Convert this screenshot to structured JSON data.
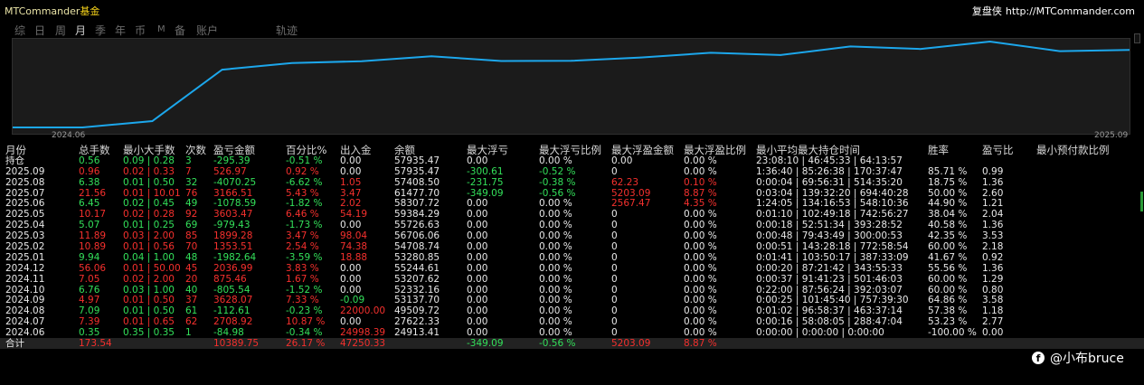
{
  "app": {
    "title_en": "MTCommander",
    "title_cn": "基金",
    "brand_cn": "复盘侠",
    "brand_url": "http://MTCommander.com"
  },
  "tabs": [
    {
      "label": "综",
      "active": false
    },
    {
      "label": "日",
      "active": false
    },
    {
      "label": "周",
      "active": false
    },
    {
      "label": "月",
      "active": true
    },
    {
      "label": "季",
      "active": false
    },
    {
      "label": "年",
      "active": false
    },
    {
      "label": "币",
      "active": false
    },
    {
      "label": "M",
      "active": false
    },
    {
      "label": "备",
      "active": false
    },
    {
      "label": "账户",
      "active": false
    },
    {
      "label": "轨迹",
      "active": false
    }
  ],
  "chart_data": {
    "type": "line",
    "x_tick_labels": [
      "2024.06",
      "2025.09"
    ],
    "series": [
      {
        "color": "#1ca7ec",
        "values": [
          24913.41,
          24913.41,
          27622.33,
          49509.72,
          52332.16,
          53137.7,
          55244.61,
          53207.62,
          53280.85,
          54708.74,
          56706.06,
          55726.63,
          59384.29,
          58307.72,
          61477.7,
          57408.5,
          57935.47
        ]
      }
    ]
  },
  "table": {
    "headers": [
      "月份",
      "总手数",
      "最小大手数",
      "次数",
      "盈亏金额",
      "百分比%",
      "出入金",
      "余额",
      "最大浮亏",
      "最大浮亏比例",
      "最大浮盈金额",
      "最大浮盈比例",
      "最小平均最大持仓时间",
      "胜率",
      "盈亏比",
      "最小预付款比例"
    ],
    "rows": [
      {
        "c": [
          "持仓",
          "0.56",
          "0.09 | 0.28",
          "3",
          "-295.39",
          "-0.51 %",
          "0.00",
          "57935.47",
          "0.00",
          "0.00 %",
          "0.00",
          "0.00 %",
          "23:08:10 | 46:45:33 | 64:13:57",
          "",
          "",
          ""
        ],
        "k": [
          "w",
          "g",
          "g",
          "g",
          "g",
          "g",
          "w",
          "w",
          "w",
          "w",
          "w",
          "w",
          "w",
          "w",
          "w",
          "w"
        ]
      },
      {
        "c": [
          "2025.09",
          "0.96",
          "0.02 | 0.33",
          "7",
          "526.97",
          "0.92 %",
          "0.00",
          "57935.47",
          "-300.61",
          "-0.52 %",
          "0",
          "0.00 %",
          "1:36:40 | 85:26:38 | 170:37:47",
          "85.71 %",
          "0.99",
          ""
        ],
        "k": [
          "w",
          "r",
          "r",
          "r",
          "r",
          "r",
          "w",
          "w",
          "g",
          "g",
          "w",
          "w",
          "w",
          "w",
          "w",
          "w"
        ]
      },
      {
        "c": [
          "2025.08",
          "6.38",
          "0.01 | 0.50",
          "32",
          "-4070.25",
          "-6.62 %",
          "1.05",
          "57408.50",
          "-231.75",
          "-0.38 %",
          "62.23",
          "0.10 %",
          "0:00:04 | 69:56:31 | 514:35:20",
          "18.75 %",
          "1.36",
          ""
        ],
        "k": [
          "w",
          "g",
          "g",
          "g",
          "g",
          "g",
          "r",
          "w",
          "g",
          "g",
          "r",
          "r",
          "w",
          "w",
          "w",
          "w"
        ]
      },
      {
        "c": [
          "2025.07",
          "21.56",
          "0.01 | 10.01",
          "76",
          "3166.51",
          "5.43 %",
          "3.47",
          "61477.70",
          "-349.09",
          "-0.56 %",
          "5203.09",
          "8.87 %",
          "0:03:04 | 139:32:20 | 694:40:28",
          "50.00 %",
          "2.60",
          ""
        ],
        "k": [
          "w",
          "r",
          "r",
          "r",
          "r",
          "r",
          "r",
          "w",
          "g",
          "g",
          "r",
          "r",
          "w",
          "w",
          "w",
          "w"
        ]
      },
      {
        "c": [
          "2025.06",
          "6.45",
          "0.02 | 0.45",
          "49",
          "-1078.59",
          "-1.82 %",
          "2.02",
          "58307.72",
          "0.00",
          "0.00 %",
          "2567.47",
          "4.35 %",
          "1:24:05 | 134:16:53 | 548:10:36",
          "44.90 %",
          "1.21",
          ""
        ],
        "k": [
          "w",
          "g",
          "g",
          "g",
          "g",
          "g",
          "r",
          "w",
          "w",
          "w",
          "r",
          "r",
          "w",
          "w",
          "w",
          "w"
        ]
      },
      {
        "c": [
          "2025.05",
          "10.17",
          "0.02 | 0.28",
          "92",
          "3603.47",
          "6.46 %",
          "54.19",
          "59384.29",
          "0.00",
          "0.00 %",
          "0",
          "0.00 %",
          "0:01:10 | 102:49:18 | 742:56:27",
          "38.04 %",
          "2.04",
          ""
        ],
        "k": [
          "w",
          "r",
          "r",
          "r",
          "r",
          "r",
          "r",
          "w",
          "w",
          "w",
          "w",
          "w",
          "w",
          "w",
          "w",
          "w"
        ]
      },
      {
        "c": [
          "2025.04",
          "5.07",
          "0.01 | 0.25",
          "69",
          "-979.43",
          "-1.73 %",
          "0.00",
          "55726.63",
          "0.00",
          "0.00 %",
          "0",
          "0.00 %",
          "0:00:18 | 52:51:34 | 393:28:52",
          "40.58 %",
          "1.36",
          ""
        ],
        "k": [
          "w",
          "g",
          "g",
          "g",
          "g",
          "g",
          "w",
          "w",
          "w",
          "w",
          "w",
          "w",
          "w",
          "w",
          "w",
          "w"
        ]
      },
      {
        "c": [
          "2025.03",
          "11.89",
          "0.03 | 2.00",
          "85",
          "1899.28",
          "3.47 %",
          "98.04",
          "56706.06",
          "0.00",
          "0.00 %",
          "0",
          "0.00 %",
          "0:00:48 | 79:43:49 | 300:00:53",
          "42.35 %",
          "3.53",
          ""
        ],
        "k": [
          "w",
          "r",
          "r",
          "r",
          "r",
          "r",
          "r",
          "w",
          "w",
          "w",
          "w",
          "w",
          "w",
          "w",
          "w",
          "w"
        ]
      },
      {
        "c": [
          "2025.02",
          "10.89",
          "0.01 | 0.56",
          "70",
          "1353.51",
          "2.54 %",
          "74.38",
          "54708.74",
          "0.00",
          "0.00 %",
          "0",
          "0.00 %",
          "0:00:51 | 143:28:18 | 772:58:54",
          "60.00 %",
          "2.18",
          ""
        ],
        "k": [
          "w",
          "r",
          "r",
          "r",
          "r",
          "r",
          "r",
          "w",
          "w",
          "w",
          "w",
          "w",
          "w",
          "w",
          "w",
          "w"
        ]
      },
      {
        "c": [
          "2025.01",
          "9.94",
          "0.04 | 1.00",
          "48",
          "-1982.64",
          "-3.59 %",
          "18.88",
          "53280.85",
          "0.00",
          "0.00 %",
          "0",
          "0.00 %",
          "0:01:41 | 103:50:17 | 387:33:09",
          "41.67 %",
          "0.92",
          ""
        ],
        "k": [
          "w",
          "g",
          "g",
          "g",
          "g",
          "g",
          "r",
          "w",
          "w",
          "w",
          "w",
          "w",
          "w",
          "w",
          "w",
          "w"
        ]
      },
      {
        "c": [
          "2024.12",
          "56.06",
          "0.01 | 50.00",
          "45",
          "2036.99",
          "3.83 %",
          "0.00",
          "55244.61",
          "0.00",
          "0.00 %",
          "0",
          "0.00 %",
          "0:00:20 | 87:21:42 | 343:55:33",
          "55.56 %",
          "1.36",
          ""
        ],
        "k": [
          "w",
          "r",
          "r",
          "r",
          "r",
          "r",
          "w",
          "w",
          "w",
          "w",
          "w",
          "w",
          "w",
          "w",
          "w",
          "w"
        ]
      },
      {
        "c": [
          "2024.11",
          "7.05",
          "0.02 | 2.00",
          "20",
          "875.46",
          "1.67 %",
          "0.00",
          "53207.62",
          "0.00",
          "0.00 %",
          "0",
          "0.00 %",
          "0:00:37 | 91:41:23 | 501:46:03",
          "60.00 %",
          "1.29",
          ""
        ],
        "k": [
          "w",
          "r",
          "r",
          "r",
          "r",
          "r",
          "w",
          "w",
          "w",
          "w",
          "w",
          "w",
          "w",
          "w",
          "w",
          "w"
        ]
      },
      {
        "c": [
          "2024.10",
          "6.76",
          "0.03 | 1.00",
          "40",
          "-805.54",
          "-1.52 %",
          "0.00",
          "52332.16",
          "0.00",
          "0.00 %",
          "0",
          "0.00 %",
          "0:22:00 | 87:56:24 | 392:03:07",
          "60.00 %",
          "0.80",
          ""
        ],
        "k": [
          "w",
          "g",
          "g",
          "g",
          "g",
          "g",
          "w",
          "w",
          "w",
          "w",
          "w",
          "w",
          "w",
          "w",
          "w",
          "w"
        ]
      },
      {
        "c": [
          "2024.09",
          "4.97",
          "0.01 | 0.50",
          "37",
          "3628.07",
          "7.33 %",
          "-0.09",
          "53137.70",
          "0.00",
          "0.00 %",
          "0",
          "0.00 %",
          "0:00:25 | 101:45:40 | 757:39:30",
          "64.86 %",
          "3.58",
          ""
        ],
        "k": [
          "w",
          "r",
          "r",
          "r",
          "r",
          "r",
          "g",
          "w",
          "w",
          "w",
          "w",
          "w",
          "w",
          "w",
          "w",
          "w"
        ]
      },
      {
        "c": [
          "2024.08",
          "7.09",
          "0.01 | 0.50",
          "61",
          "-112.61",
          "-0.23 %",
          "22000.00",
          "49509.72",
          "0.00",
          "0.00 %",
          "0",
          "0.00 %",
          "0:01:02 | 96:58:37 | 463:37:14",
          "57.38 %",
          "1.18",
          ""
        ],
        "k": [
          "w",
          "g",
          "g",
          "g",
          "g",
          "g",
          "r",
          "w",
          "w",
          "w",
          "w",
          "w",
          "w",
          "w",
          "w",
          "w"
        ]
      },
      {
        "c": [
          "2024.07",
          "7.39",
          "0.01 | 0.65",
          "62",
          "2708.92",
          "10.87 %",
          "0.00",
          "27622.33",
          "0.00",
          "0.00 %",
          "0",
          "0.00 %",
          "0:00:16 | 58:08:05 | 288:47:04",
          "53.23 %",
          "2.77",
          ""
        ],
        "k": [
          "w",
          "r",
          "r",
          "r",
          "r",
          "r",
          "w",
          "w",
          "w",
          "w",
          "w",
          "w",
          "w",
          "w",
          "w",
          "w"
        ]
      },
      {
        "c": [
          "2024.06",
          "0.35",
          "0.35 | 0.35",
          "1",
          "-84.98",
          "-0.34 %",
          "24998.39",
          "24913.41",
          "0.00",
          "0.00 %",
          "0",
          "0.00 %",
          "0:00:00 | 0:00:00 | 0:00:00",
          "-100.00 %",
          "0.00",
          ""
        ],
        "k": [
          "w",
          "g",
          "g",
          "g",
          "g",
          "g",
          "r",
          "w",
          "w",
          "w",
          "w",
          "w",
          "w",
          "w",
          "w",
          "w"
        ]
      },
      {
        "c": [
          "合计",
          "173.54",
          "",
          "",
          "10389.75",
          "26.17 %",
          "47250.33",
          "",
          "-349.09",
          "-0.56 %",
          "5203.09",
          "8.87 %",
          "",
          "",
          "",
          ""
        ],
        "k": [
          "w",
          "r",
          "r",
          "r",
          "r",
          "r",
          "r",
          "w",
          "g",
          "g",
          "r",
          "r",
          "w",
          "w",
          "w",
          "w"
        ]
      }
    ]
  },
  "watermark": {
    "icon": "facebook-icon",
    "text": "@小布bruce"
  }
}
